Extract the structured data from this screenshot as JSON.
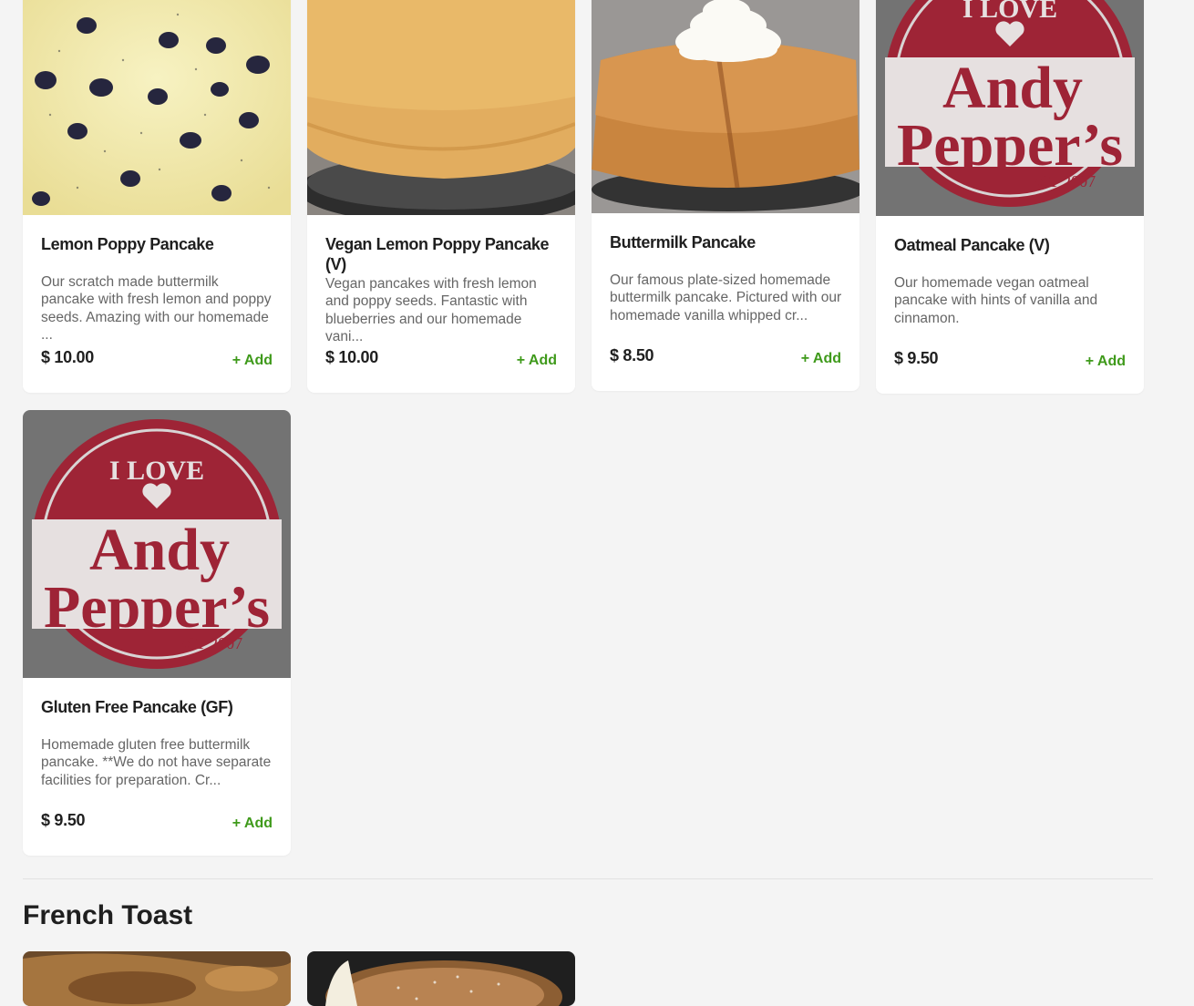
{
  "items": [
    {
      "name": "Lemon Poppy Pancake",
      "description": "Our scratch made buttermilk pancake with fresh lemon and poppy seeds. Amazing with our homemade ...",
      "price": "$ 10.00",
      "add_label": "+ Add",
      "image": "lemon-poppy-pancake-photo"
    },
    {
      "name": "Vegan Lemon Poppy Pancake (V)",
      "description": "Vegan pancakes with fresh lemon and poppy seeds. Fantastic with blueberries and our homemade vani...",
      "price": "$ 10.00",
      "add_label": "+ Add",
      "image": "vegan-lemon-poppy-pancake-photo"
    },
    {
      "name": "Buttermilk Pancake",
      "description": "Our famous plate-sized homemade buttermilk pancake. Pictured with our homemade vanilla whipped cr...",
      "price": "$ 8.50",
      "add_label": "+ Add",
      "image": "buttermilk-pancake-photo"
    },
    {
      "name": "Oatmeal Pancake (V)",
      "description": "Our homemade vegan oatmeal pancake with hints of vanilla and cinnamon.",
      "price": "$ 9.50",
      "add_label": "+ Add",
      "image": "andy-peppers-logo"
    },
    {
      "name": "Gluten Free Pancake (GF)",
      "description": "Homemade gluten free buttermilk pancake. **We do not have separate facilities for preparation. Cr...",
      "price": "$ 9.50",
      "add_label": "+ Add",
      "image": "andy-peppers-logo"
    }
  ],
  "logo": {
    "top": "I LOVE",
    "line1": "Andy",
    "line2": "Pepper’s",
    "est": "EST 2007"
  },
  "section": {
    "title": "French Toast"
  },
  "colors": {
    "accent_green": "#3f9a1b",
    "logo_red": "#9b2335",
    "background": "#f4f4f4"
  }
}
